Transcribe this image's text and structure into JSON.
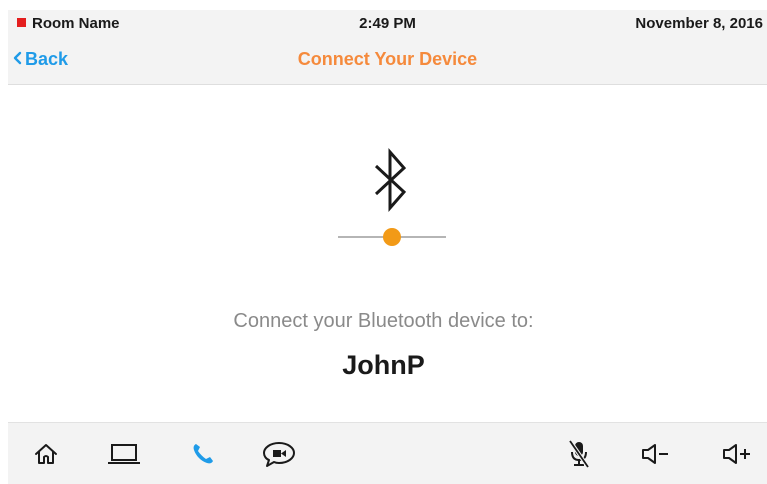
{
  "status_bar": {
    "room_name": "Room Name",
    "time": "2:49 PM",
    "date": "November 8, 2016",
    "room_indicator_color": "#e41e1e"
  },
  "header": {
    "back_label": "Back",
    "title": "Connect Your Device",
    "title_color": "#f58a3c",
    "back_color": "#1f9be8"
  },
  "main": {
    "icon": "bluetooth-icon",
    "connection_progress": 0.5,
    "progress_color": "#f29a17",
    "connect_label": "Connect your Bluetooth device to:",
    "device_name": "JohnP"
  },
  "bottom_bar": {
    "buttons": [
      {
        "name": "home",
        "icon": "home-icon"
      },
      {
        "name": "presentation",
        "icon": "laptop-icon"
      },
      {
        "name": "phone",
        "icon": "phone-icon",
        "active": true
      },
      {
        "name": "video-conference",
        "icon": "video-chat-icon"
      },
      {
        "name": "mic-mute",
        "icon": "mic-muted-icon"
      },
      {
        "name": "volume-down",
        "icon": "volume-down-icon"
      },
      {
        "name": "volume-up",
        "icon": "volume-up-icon"
      }
    ],
    "active_color": "#1f9be8"
  }
}
